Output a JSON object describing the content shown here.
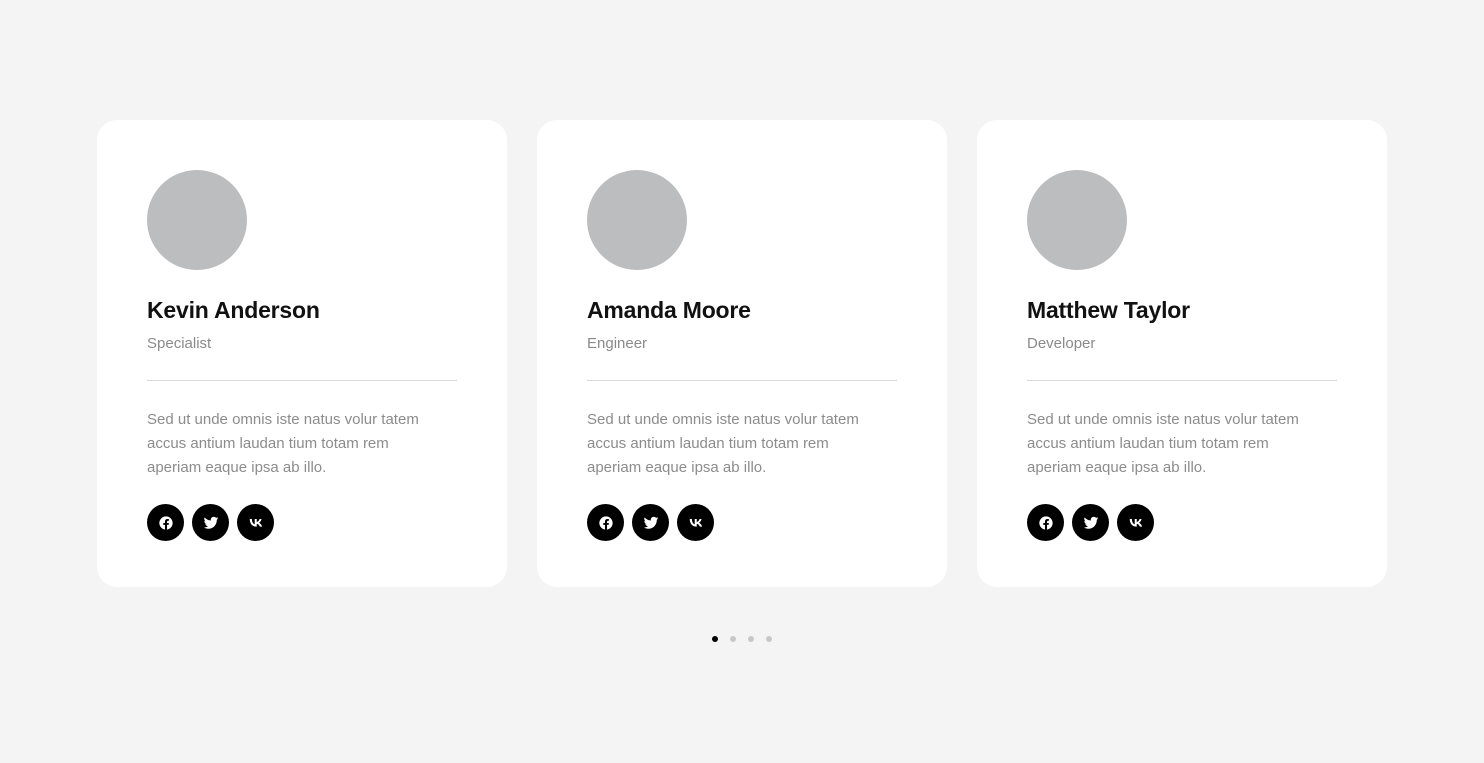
{
  "team": {
    "members": [
      {
        "name": "Kevin Anderson",
        "role": "Specialist",
        "bio": "Sed ut unde omnis iste natus volur tatem accus antium laudan tium totam rem aperiam eaque ipsa ab illo."
      },
      {
        "name": "Amanda Moore",
        "role": "Engineer",
        "bio": "Sed ut unde omnis iste natus volur tatem accus antium laudan tium totam rem aperiam eaque ipsa ab illo."
      },
      {
        "name": "Matthew Taylor",
        "role": "Developer",
        "bio": "Sed ut unde omnis iste natus volur tatem accus antium laudan tium totam rem aperiam eaque ipsa ab illo."
      }
    ],
    "social_icons": [
      "facebook-icon",
      "twitter-icon",
      "vk-icon"
    ]
  },
  "pagination": {
    "total": 4,
    "active_index": 0
  },
  "colors": {
    "background": "#f4f4f4",
    "card": "#ffffff",
    "avatar_placeholder": "#bcbdbf",
    "social_button": "#000000",
    "dot_active": "#000000",
    "dot_inactive": "#c8c8c8"
  }
}
